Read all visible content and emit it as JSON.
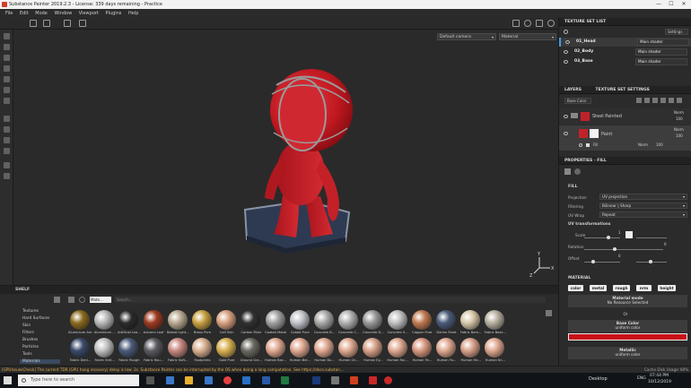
{
  "window": {
    "title": "Substance Painter 2019.2.3 - License: 339 days remaining - Practice",
    "minimize": "—",
    "maximize": "☐",
    "close": "✕"
  },
  "menu": [
    "File",
    "Edit",
    "Mode",
    "Window",
    "Viewport",
    "Plugins",
    "Help"
  ],
  "viewport": {
    "camera": "Default camera",
    "channel": "Material"
  },
  "texture_set_list": {
    "title": "TEXTURE SET LIST",
    "settings": "Settings",
    "rows": [
      {
        "name": "01_Head",
        "shader": "Main shader"
      },
      {
        "name": "02_Body",
        "shader": "Main shader"
      },
      {
        "name": "03_Base",
        "shader": "Main shader"
      }
    ]
  },
  "layers": {
    "tab_layers": "LAYERS",
    "tab_settings": "TEXTURE SET SETTINGS",
    "channel": "Base Color",
    "items": [
      {
        "name": "Steel Painted",
        "blend": "Norm",
        "opacity": "100"
      },
      {
        "name": "Paint",
        "blend": "Norm",
        "opacity": "100",
        "fill_blend": "Norm",
        "fill_opacity": "100",
        "fill_label": "Fill"
      }
    ]
  },
  "properties": {
    "title": "PROPERTIES - FILL",
    "fill_header": "FILL",
    "projection_label": "Projection",
    "projection_value": "UV projection",
    "filtering_label": "Filtering",
    "filtering_value": "Bilinear | Sharp",
    "uvwrap_label": "UV Wrap",
    "uvwrap_value": "Repeat",
    "uvtrans_header": "UV transformations",
    "scale_label": "Scale",
    "scale_value": "1",
    "rotation_label": "Rotation",
    "rotation_value": "0",
    "offset_label": "Offset",
    "offset_value": "0",
    "material_header": "MATERIAL",
    "channels": [
      "color",
      "metal",
      "rough",
      "nrm",
      "height"
    ],
    "material_mode_title": "Material mode",
    "material_mode_value": "No Resource Selected",
    "or_text": "Or",
    "base_color_title": "Base Color",
    "base_color_value": "uniform color",
    "base_color_hex": "#c8101a",
    "metallic_title": "Metallic",
    "metallic_value": "uniform color"
  },
  "shelf": {
    "title": "SHELF",
    "search_tag": "Mate...",
    "search_placeholder": "Search...",
    "categories": [
      "Textures",
      "Hard Surfaces",
      "Skin",
      "Filters",
      "Brushes",
      "Particles",
      "Tools",
      "Materials"
    ],
    "selected_category": "Materials",
    "row1": [
      {
        "label": "Aluminium Am...",
        "color": "#8a6a1e"
      },
      {
        "label": "Aluminium ...",
        "color": "#b8b8b8"
      },
      {
        "label": "Artificial Lea...",
        "color": "#2a2a2a"
      },
      {
        "label": "Autumn Leaf",
        "color": "#9c3a20"
      },
      {
        "label": "Baked Light...",
        "color": "#b8a890"
      },
      {
        "label": "Brass Pure",
        "color": "#c8a040"
      },
      {
        "label": "Calf Skin",
        "color": "#d8a080"
      },
      {
        "label": "Carbon Fiber",
        "color": "#303030"
      },
      {
        "label": "Coated Metal",
        "color": "#a0a0a0"
      },
      {
        "label": "Cobalt Pure",
        "color": "#c0c4c8"
      },
      {
        "label": "Concrete B...",
        "color": "#a8a8a8"
      },
      {
        "label": "Concrete C...",
        "color": "#b0b0b0"
      },
      {
        "label": "Concrete D...",
        "color": "#989898"
      },
      {
        "label": "Concrete S...",
        "color": "#c0c0c0"
      },
      {
        "label": "Copper Pure",
        "color": "#c07a50"
      },
      {
        "label": "Denim Rivet",
        "color": "#4a5a78"
      },
      {
        "label": "Fabric Bam...",
        "color": "#d8c8a8"
      },
      {
        "label": "Fabric Base...",
        "color": "#b8b0a0"
      }
    ],
    "row2": [
      {
        "label": "Fabric Deni...",
        "color": "#3a4a68"
      },
      {
        "label": "Fabric Knit...",
        "color": "#c0c0c0"
      },
      {
        "label": "Fabric Rough",
        "color": "#4a5a78"
      },
      {
        "label": "Fabric Rou...",
        "color": "#5a5a60"
      },
      {
        "label": "Fabric Soft...",
        "color": "#c88880"
      },
      {
        "label": "Footprints",
        "color": "#d8b090"
      },
      {
        "label": "Gold Pure",
        "color": "#d8b050"
      },
      {
        "label": "Ground Gra...",
        "color": "#6a6a60"
      },
      {
        "label": "Human Bac...",
        "color": "#e0a890"
      },
      {
        "label": "Human Bel...",
        "color": "#e0a890"
      },
      {
        "label": "Human Bu...",
        "color": "#e0a890"
      },
      {
        "label": "Human Ch...",
        "color": "#e0a890"
      },
      {
        "label": "Human Ey...",
        "color": "#d8a088"
      },
      {
        "label": "Human Fac...",
        "color": "#e0a890"
      },
      {
        "label": "Human Fe...",
        "color": "#d89880"
      },
      {
        "label": "Human Fo...",
        "color": "#e0a890"
      },
      {
        "label": "Human He...",
        "color": "#d8a088"
      },
      {
        "label": "Human Kn...",
        "color": "#e0a890"
      }
    ]
  },
  "status": {
    "message": "[GPUIssuesCheck] The current TDR (GPU hang recovery) delay is low: 2s. Substance Painter can be interrupted by the OS when doing a long computation. See https://docs.substan...",
    "cache": "Cache Disk Usage:",
    "cache_value": "60%"
  },
  "taskbar": {
    "search_placeholder": "Type here to search",
    "desktop": "Desktop",
    "lang": "ENG",
    "time": "07:44 PM",
    "date": "10/12/2019"
  }
}
